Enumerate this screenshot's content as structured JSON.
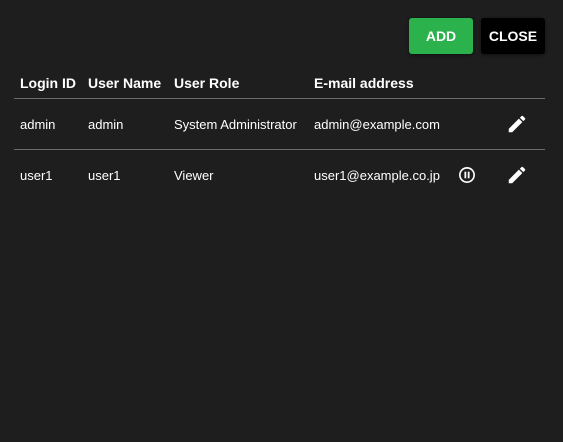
{
  "toolbar": {
    "add_label": "ADD",
    "close_label": "CLOSE"
  },
  "colors": {
    "background": "#1e1e1e",
    "add_button": "#2bb24c",
    "close_button": "#000000",
    "divider": "#6b6b6b"
  },
  "table": {
    "headers": {
      "login_id": "Login ID",
      "user_name": "User Name",
      "user_role": "User Role",
      "email": "E-mail address"
    },
    "rows": [
      {
        "login_id": "admin",
        "user_name": "admin",
        "user_role": "System Administrator",
        "email": "admin@example.com",
        "icons": [
          "edit-icon"
        ]
      },
      {
        "login_id": "user1",
        "user_name": "user1",
        "user_role": "Viewer",
        "email": "user1@example.co.jp",
        "icons": [
          "pause-circle-icon",
          "edit-icon"
        ]
      }
    ]
  }
}
